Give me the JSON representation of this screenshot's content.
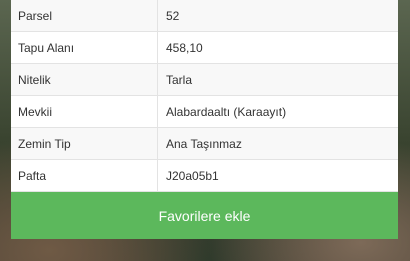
{
  "parcel_info": {
    "rows": [
      {
        "label": "Parsel",
        "value": "52"
      },
      {
        "label": "Tapu Alanı",
        "value": "458,10"
      },
      {
        "label": "Nitelik",
        "value": "Tarla"
      },
      {
        "label": "Mevkii",
        "value": "Alabardaaltı (Karaayıt)"
      },
      {
        "label": "Zemin Tip",
        "value": "Ana Taşınmaz"
      },
      {
        "label": "Pafta",
        "value": "J20a05b1"
      }
    ]
  },
  "actions": {
    "favorite_label": "Favorilere ekle"
  },
  "colors": {
    "button_green": "#5cb85c",
    "row_alt": "#f8f8f8"
  }
}
